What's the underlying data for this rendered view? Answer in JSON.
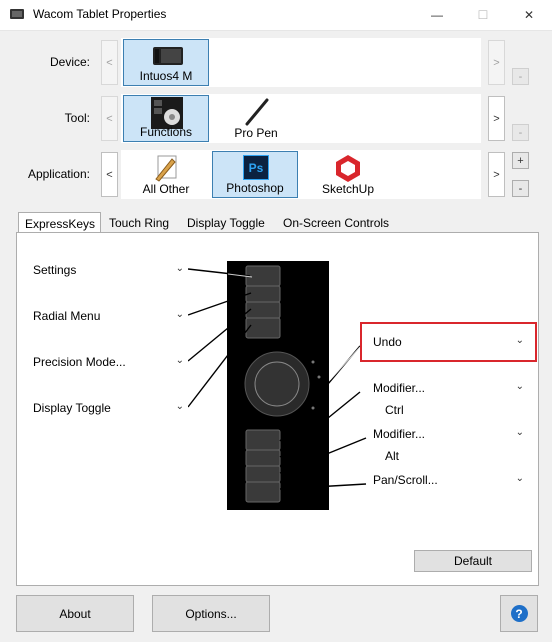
{
  "window": {
    "title": "Wacom Tablet Properties"
  },
  "rows": {
    "device": {
      "label": "Device:",
      "items": [
        {
          "label": "Intuos4 M"
        }
      ]
    },
    "tool": {
      "label": "Tool:",
      "items": [
        {
          "label": "Functions"
        },
        {
          "label": "Pro Pen"
        }
      ]
    },
    "application": {
      "label": "Application:",
      "items": [
        {
          "label": "All Other"
        },
        {
          "label": "Photoshop"
        },
        {
          "label": "SketchUp"
        }
      ]
    }
  },
  "tabs": [
    {
      "label": "ExpressKeys",
      "active": true
    },
    {
      "label": "Touch Ring"
    },
    {
      "label": "Display Toggle"
    },
    {
      "label": "On-Screen Controls"
    }
  ],
  "left_keys": [
    {
      "value": "Settings"
    },
    {
      "value": "Radial Menu"
    },
    {
      "value": "Precision Mode..."
    },
    {
      "value": "Display Toggle"
    }
  ],
  "right_keys": [
    {
      "value": "Undo",
      "highlighted": true
    },
    {
      "value": "Modifier...",
      "sub": "Ctrl"
    },
    {
      "value": "Modifier...",
      "sub": "Alt"
    },
    {
      "value": "Pan/Scroll..."
    }
  ],
  "buttons": {
    "default": "Default",
    "about": "About",
    "options": "Options...",
    "help": "?"
  },
  "symbols": {
    "left_arrow": "<",
    "right_arrow": ">",
    "plus": "+",
    "minus": "-",
    "minimize": "—",
    "maximize": "☐",
    "close": "✕",
    "chevron": "⌄"
  },
  "colors": {
    "accent": "#3c7fb1",
    "highlight_border": "#d9262c",
    "selection": "#cce4f7"
  }
}
